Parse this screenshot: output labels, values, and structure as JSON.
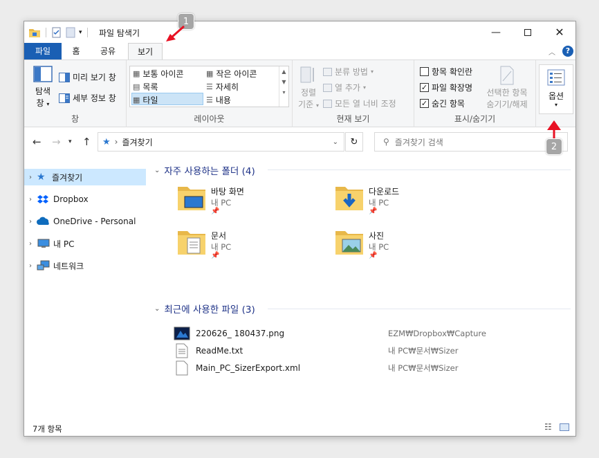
{
  "window": {
    "title": "파일 탐색기"
  },
  "tabs": {
    "file": "파일",
    "home": "홈",
    "share": "공유",
    "view": "보기"
  },
  "ribbon": {
    "pane": {
      "label": "창",
      "nav_pane_line1": "탐색",
      "nav_pane_line2": "창",
      "preview": "미리 보기 창",
      "details": "세부 정보 창"
    },
    "layout": {
      "label": "레이아웃",
      "items": [
        "보통 아이콘",
        "작은 아이콘",
        "목록",
        "자세히",
        "타일",
        "내용"
      ]
    },
    "current_view": {
      "label": "현재 보기",
      "sort_line1": "정렬",
      "sort_line2": "기준",
      "group_by": "분류 방법",
      "add_columns": "열 추가",
      "fit_columns": "모든 열 너비 조정"
    },
    "show_hide": {
      "label": "표시/숨기기",
      "checkboxes": "항목 확인란",
      "extensions": "파일 확장명",
      "hidden_items": "숨긴 항목",
      "hide_selected_line1": "선택한 항목",
      "hide_selected_line2": "숨기기/해제"
    },
    "options": {
      "label": "옵션"
    }
  },
  "address": {
    "location": "즐겨찾기",
    "search_placeholder": "즐겨찾기 검색"
  },
  "nav": {
    "items": [
      "즐겨찾기",
      "Dropbox",
      "OneDrive - Personal",
      "내 PC",
      "네트워크"
    ]
  },
  "content": {
    "frequent_header": "자주 사용하는 폴더 (4)",
    "frequent": [
      {
        "name": "바탕 화면",
        "location": "내 PC"
      },
      {
        "name": "다운로드",
        "location": "내 PC"
      },
      {
        "name": "문서",
        "location": "내 PC"
      },
      {
        "name": "사진",
        "location": "내 PC"
      }
    ],
    "recent_header": "최근에 사용한 파일 (3)",
    "recent": [
      {
        "name": "220626_ 180437.png",
        "path": "EZM₩Dropbox₩Capture"
      },
      {
        "name": "ReadMe.txt",
        "path": "내 PC₩문서₩Sizer"
      },
      {
        "name": "Main_PC_SizerExport.xml",
        "path": "내 PC₩문서₩Sizer"
      }
    ]
  },
  "status": {
    "items": "7개 항목"
  },
  "annotations": {
    "badge1": "1",
    "badge2": "2"
  },
  "colors": {
    "accent": "#1a5fb4",
    "selection": "#cce8ff",
    "arrow": "#e81123",
    "header": "#1e3287"
  }
}
